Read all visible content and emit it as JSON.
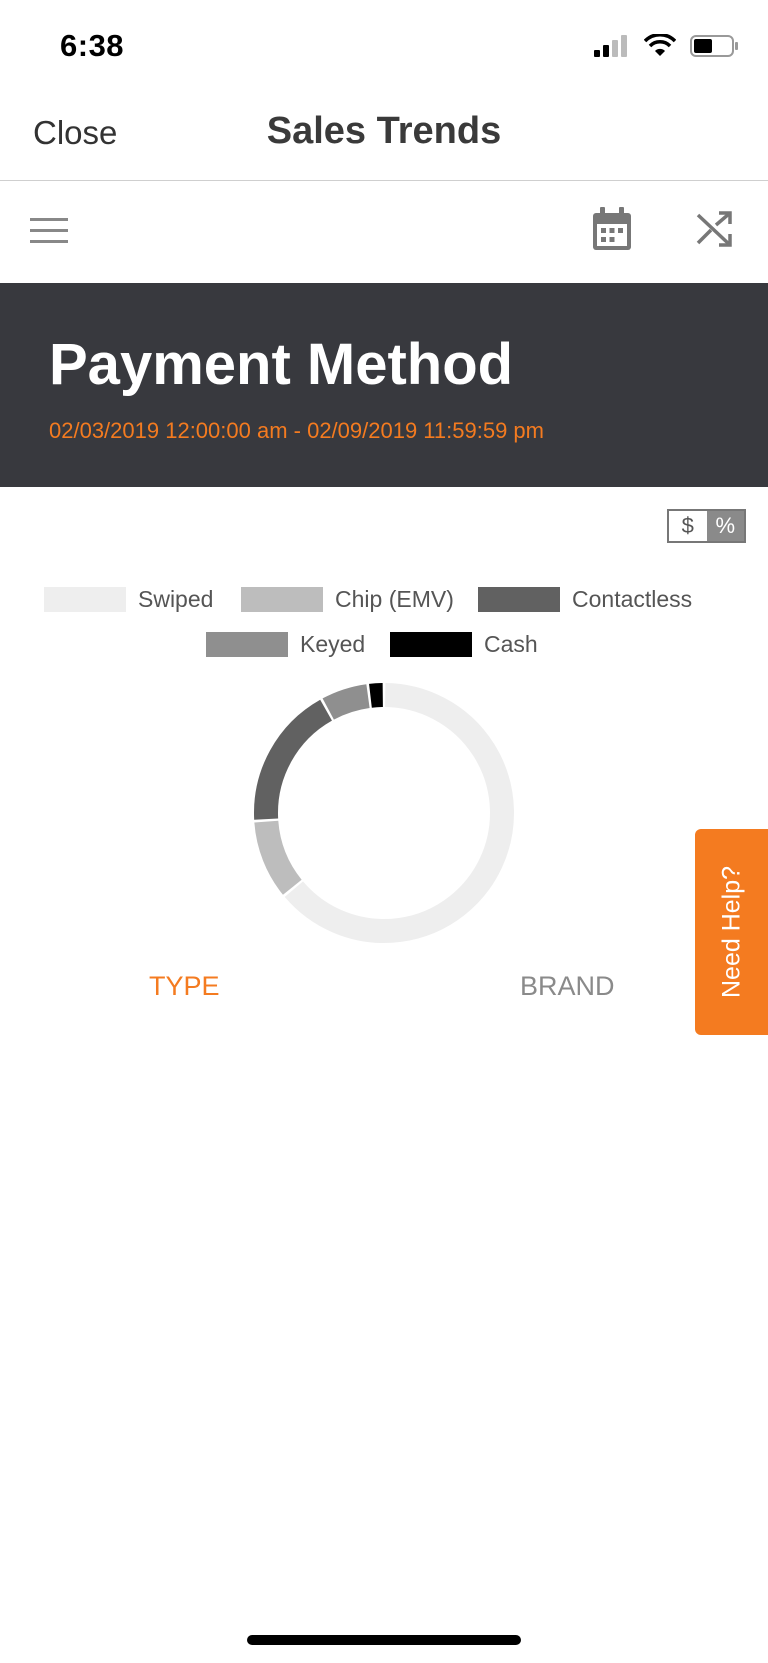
{
  "status_bar": {
    "time": "6:38"
  },
  "nav": {
    "close_label": "Close",
    "title": "Sales Trends"
  },
  "toolbar": {
    "icons": [
      "menu-icon",
      "calendar-icon",
      "shuffle-icon"
    ]
  },
  "banner": {
    "title": "Payment Method",
    "date_range": "02/03/2019 12:00:00 am - 02/09/2019 11:59:59 pm"
  },
  "unit_toggle": {
    "dollar_label": "$",
    "percent_label": "%",
    "selected": "%"
  },
  "legend": [
    {
      "label": "Swiped",
      "color": "#eeeeee"
    },
    {
      "label": "Chip (EMV)",
      "color": "#bdbdbd"
    },
    {
      "label": "Contactless",
      "color": "#616161"
    },
    {
      "label": "Keyed",
      "color": "#8f8f8f"
    },
    {
      "label": "Cash",
      "color": "#000000"
    }
  ],
  "chart_data": {
    "type": "pie",
    "categories": [
      "Swiped",
      "Chip (EMV)",
      "Contactless",
      "Keyed",
      "Cash"
    ],
    "values": [
      64,
      10,
      18,
      6,
      2
    ],
    "colors": [
      "#eeeeee",
      "#bdbdbd",
      "#616161",
      "#8f8f8f",
      "#000000"
    ],
    "style": "donut"
  },
  "tabs": {
    "type_label": "TYPE",
    "brand_label": "BRAND",
    "active": "TYPE"
  },
  "help": {
    "label": "Need Help?"
  },
  "colors": {
    "accent": "#f47b20",
    "banner_bg": "#38393e"
  }
}
